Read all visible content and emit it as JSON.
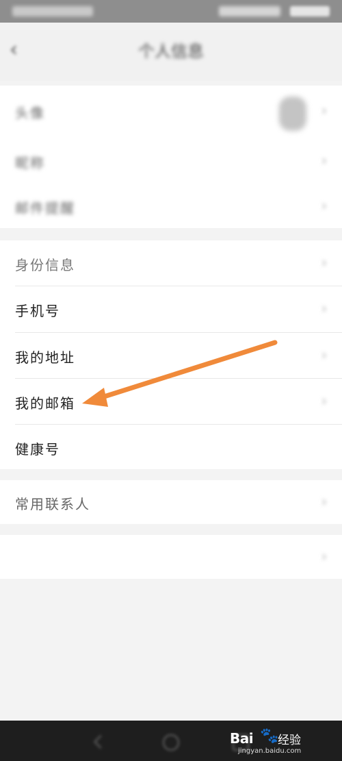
{
  "status_bar": {
    "left": "",
    "right": ""
  },
  "header": {
    "title": "个人信息",
    "back_icon": "chevron-left-icon"
  },
  "group1": {
    "rows": [
      {
        "label": "头像",
        "value": ""
      },
      {
        "label": "昵称",
        "value": ""
      },
      {
        "label": "邮件提醒",
        "value": ""
      }
    ]
  },
  "group2": {
    "rows": [
      {
        "label": "身份信息",
        "value": ""
      },
      {
        "label": "手机号",
        "value": ""
      },
      {
        "label": "我的地址",
        "value": ""
      },
      {
        "label": "我的邮箱",
        "value": ""
      },
      {
        "label": "健康号",
        "value": ""
      }
    ]
  },
  "group3": {
    "rows": [
      {
        "label": "常用联系人",
        "value": ""
      }
    ]
  },
  "group4": {
    "rows": [
      {
        "label": ""
      }
    ]
  },
  "footer_note": "",
  "chevron": "›",
  "watermark": {
    "brand": "Bai",
    "name": "经验",
    "url": "jingyan.baidu.com"
  },
  "annotation": {
    "arrow_color": "#f08a3a"
  }
}
